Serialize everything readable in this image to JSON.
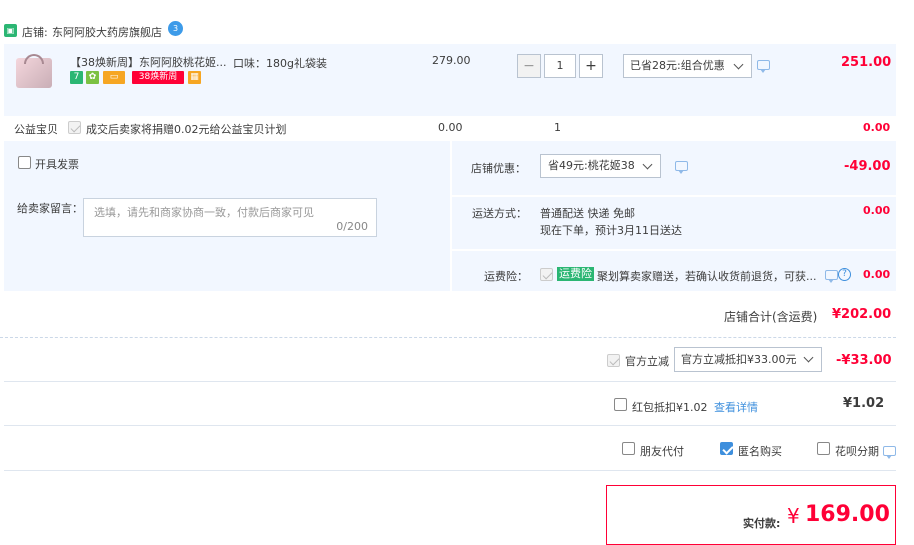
{
  "shop": {
    "prefix": "店铺:",
    "name": "东阿阿胶大药房旗舰店",
    "chat_badge": "3"
  },
  "item": {
    "title": "【38焕新周】东阿阿胶桃花姬...",
    "badge_38": "38焕新周",
    "sku": "口味：180g礼袋装",
    "unit_price": "279.00",
    "quantity": "1",
    "promo_select": "已省28元:组合优惠",
    "subtotal": "251.00"
  },
  "charity": {
    "label": "公益宝贝",
    "text": "成交后卖家将捐赠0.02元给公益宝贝计划",
    "price": "0.00",
    "qty": "1",
    "subtotal": "0.00"
  },
  "invoice": {
    "label": "开具发票"
  },
  "message": {
    "label": "给卖家留言：",
    "placeholder": "选填，请先和商家协商一致，付款后商家可见",
    "counter": "0/200"
  },
  "shop_discount": {
    "label": "店铺优惠：",
    "select": "省49元:桃花姬38",
    "amount": "-49.00"
  },
  "delivery": {
    "label": "运送方式：",
    "line1": "普通配送 快递 免邮",
    "line2": "现在下单，预计3月11日送达",
    "amount": "0.00"
  },
  "insurance": {
    "label": "运费险：",
    "tag": "运费险",
    "text": "聚划算卖家赠送，若确认收货前退货，可获...",
    "amount": "0.00"
  },
  "shop_total": {
    "label": "店铺合计(含运费)",
    "amount": "¥202.00"
  },
  "official": {
    "label": "官方立减",
    "select": "官方立减抵扣¥33.00元",
    "amount": "-¥33.00"
  },
  "redpacket": {
    "label": "红包抵扣¥1.02",
    "link": "查看详情",
    "amount": "¥1.02"
  },
  "options": {
    "friend_pay": "朋友代付",
    "anonymous": "匿名购买",
    "huabei": "花呗分期"
  },
  "pay": {
    "label": "实付款:",
    "currency": "¥",
    "amount": "169.00"
  },
  "colors": {
    "accent_red": "#ff0036",
    "blue_bg": "#f2f7ff",
    "link_blue": "#3e8fdd"
  }
}
